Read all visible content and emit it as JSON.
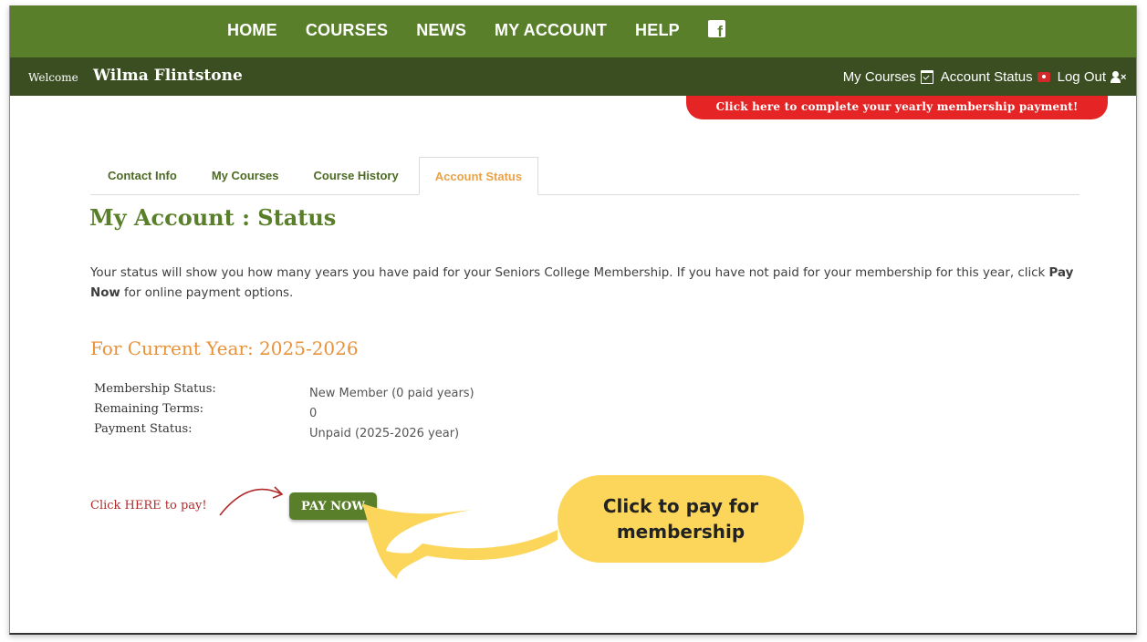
{
  "nav": {
    "items": [
      "HOME",
      "COURSES",
      "NEWS",
      "MY ACCOUNT",
      "HELP"
    ],
    "social_icon": "facebook-icon"
  },
  "welcome": {
    "label": "Welcome",
    "name": "Wilma Flintstone"
  },
  "user_links": {
    "my_courses": "My Courses",
    "account_status": "Account Status",
    "log_out": "Log Out"
  },
  "banner": {
    "text": "Click here to complete your yearly membership payment!"
  },
  "tabs": [
    {
      "label": "Contact Info",
      "active": false
    },
    {
      "label": "My Courses",
      "active": false
    },
    {
      "label": "Course History",
      "active": false
    },
    {
      "label": "Account Status",
      "active": true
    }
  ],
  "page": {
    "title": "My Account : Status",
    "desc_part1": "Your status will show you how many years you have paid for your Seniors College Membership. If you have not paid for your membership for this year, click ",
    "desc_bold": "Pay Now",
    "desc_part2": " for online payment options."
  },
  "current_year": {
    "heading": "For Current Year: 2025-2026",
    "rows": [
      {
        "label": "Membership Status:",
        "value": "New Member (0 paid years)"
      },
      {
        "label": "Remaining Terms:",
        "value": "0"
      },
      {
        "label": "Payment Status:",
        "value": "Unpaid (2025-2026 year)"
      }
    ]
  },
  "pay": {
    "hint": "Click HERE to pay!",
    "button": "PAY NOW"
  },
  "callout": {
    "text": "Click to pay for membership"
  },
  "colors": {
    "nav_green": "#5a7f2a",
    "welcome_green": "#3a4e22",
    "banner_red": "#e52425",
    "heading_orange": "#e8923a",
    "callout_yellow": "#fbd65a"
  }
}
